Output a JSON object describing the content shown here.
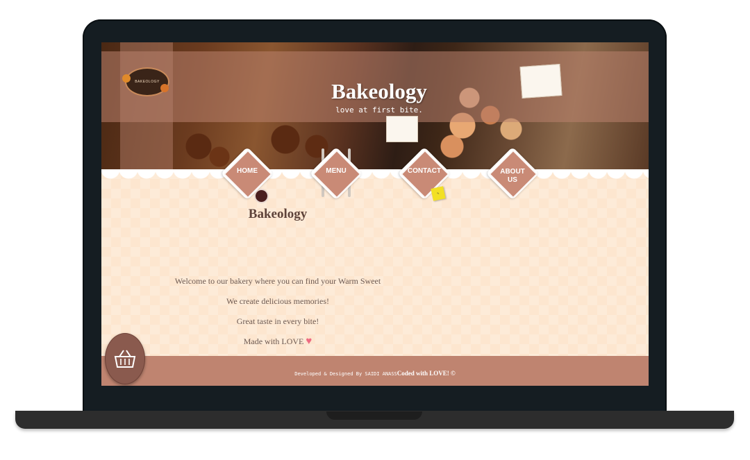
{
  "header": {
    "logo_text": "BAKEOLOGY",
    "title": "Bakeology",
    "tagline": "love at first bite."
  },
  "nav": {
    "items": [
      {
        "label": "HOME"
      },
      {
        "label": "MENU"
      },
      {
        "label": "CONTACT"
      },
      {
        "label_line1": "ABOUT",
        "label_line2": "US"
      }
    ]
  },
  "main": {
    "title": "Bakeology",
    "lines": [
      "Welcome to our bakery where you can find your Warm Sweet",
      "We create delicious memories!",
      "Great taste in every bite!",
      "Made with LOVE"
    ]
  },
  "footer": {
    "prefix": "Developed & Designed By SAIDI ANASS",
    "suffix": "Coded with LOVE! ©"
  },
  "colors": {
    "accent": "#c98a76",
    "footer": "#bf8470",
    "background": "#fde6cf",
    "heart": "#ee6a82"
  },
  "icons": {
    "cart": "shopping-basket-icon",
    "heart": "heart-icon"
  }
}
